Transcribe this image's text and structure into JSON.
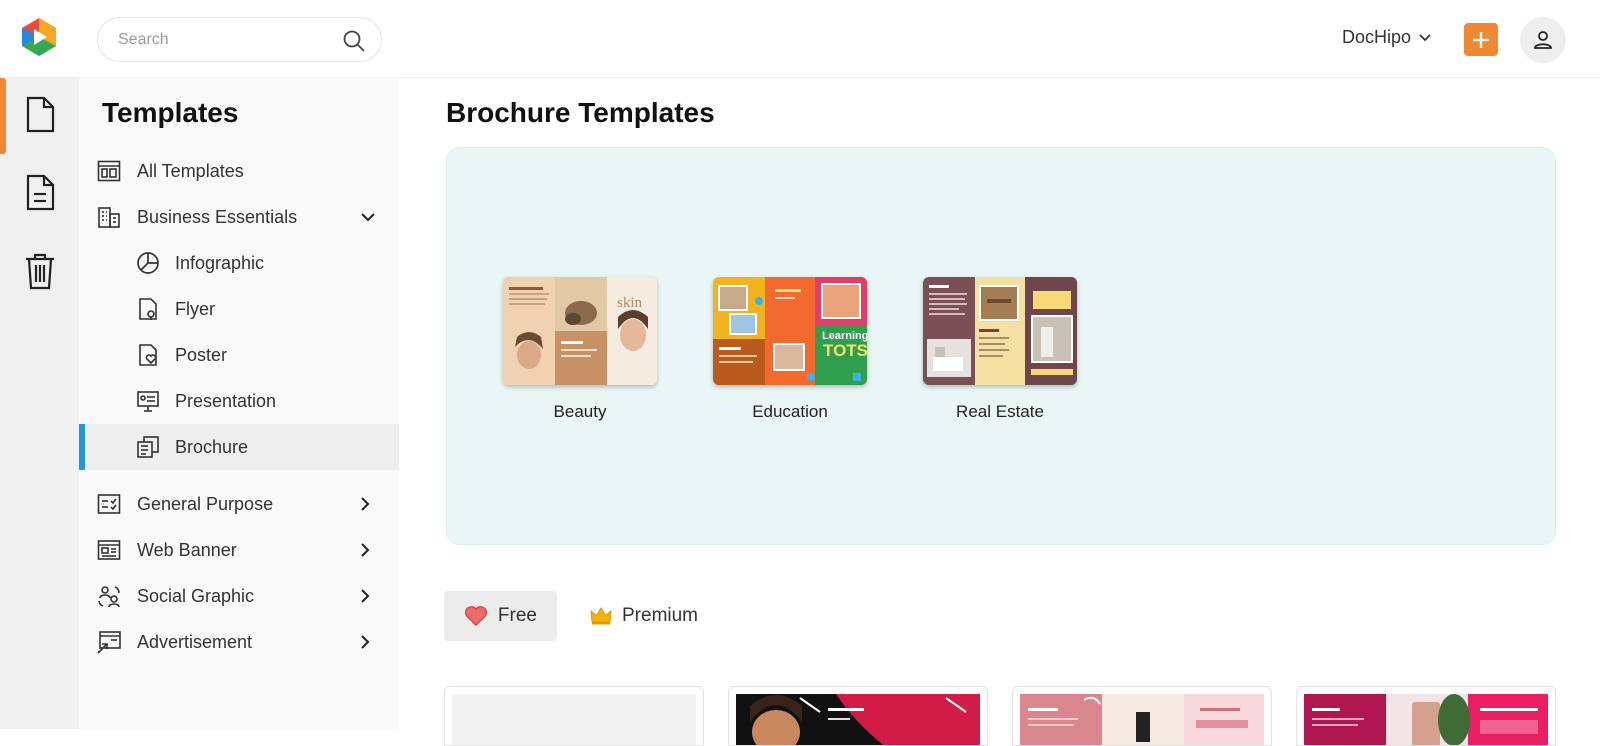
{
  "header": {
    "search_placeholder": "Search",
    "account_label": "DocHipo",
    "accent_color": "#f08833"
  },
  "rail": {
    "items": [
      {
        "name": "templates-icon",
        "active": true
      },
      {
        "name": "documents-icon",
        "active": false
      },
      {
        "name": "trash-icon",
        "active": false
      }
    ]
  },
  "sidebar": {
    "title": "Templates",
    "items": [
      {
        "label": "All Templates",
        "icon": "grid-icon"
      },
      {
        "label": "Business Essentials",
        "icon": "building-icon",
        "expanded": true
      },
      {
        "label": "Infographic",
        "icon": "pie-chart-icon"
      },
      {
        "label": "Flyer",
        "icon": "flyer-icon"
      },
      {
        "label": "Poster",
        "icon": "poster-icon"
      },
      {
        "label": "Presentation",
        "icon": "presentation-icon"
      },
      {
        "label": "Brochure",
        "icon": "brochure-icon",
        "selected": true
      },
      {
        "label": "General Purpose",
        "icon": "checklist-icon"
      },
      {
        "label": "Web Banner",
        "icon": "web-banner-icon"
      },
      {
        "label": "Social Graphic",
        "icon": "social-icon"
      },
      {
        "label": "Advertisement",
        "icon": "advertisement-icon"
      }
    ]
  },
  "main": {
    "title": "Brochure Templates",
    "categories": [
      {
        "label": "Beauty"
      },
      {
        "label": "Education"
      },
      {
        "label": "Real Estate"
      }
    ],
    "tabs": {
      "free": "Free",
      "premium": "Premium"
    }
  }
}
